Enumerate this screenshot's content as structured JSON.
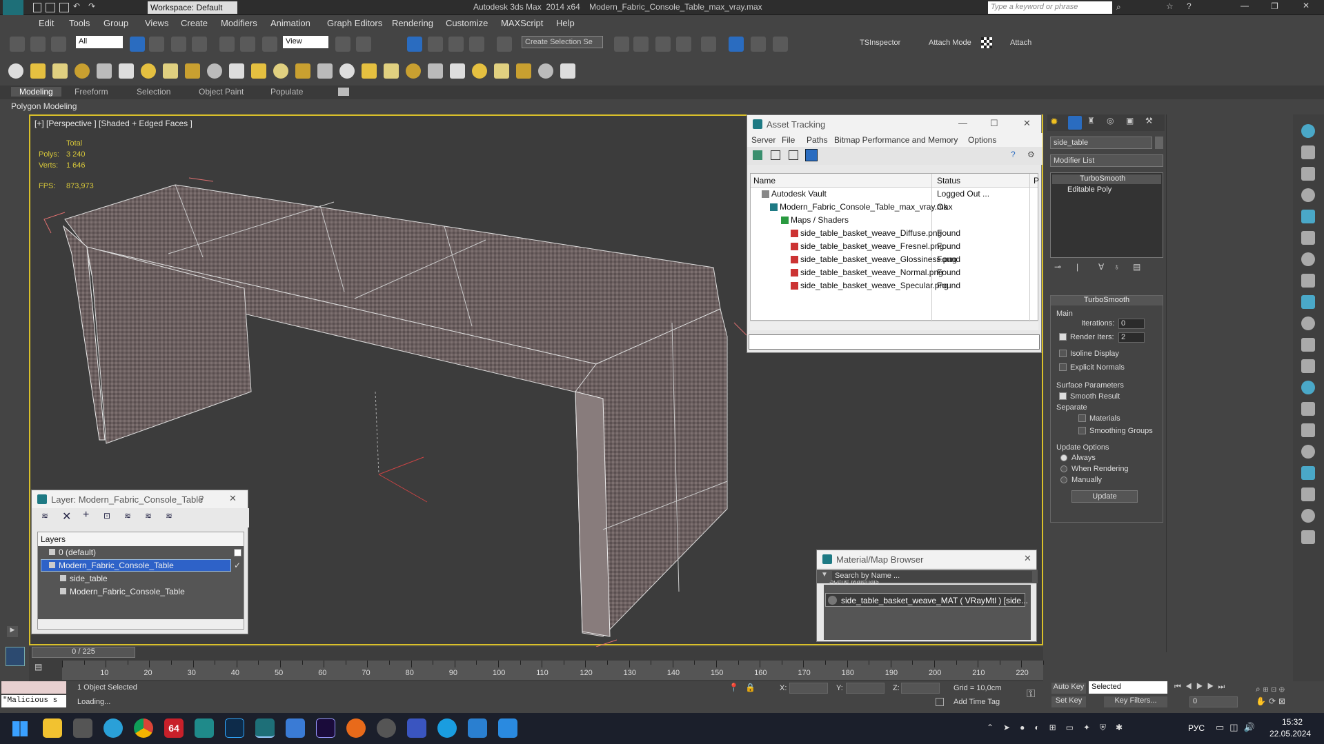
{
  "titlebar": {
    "workspace": "Workspace: Default",
    "title": "Autodesk 3ds Max  2014 x64    Modern_Fabric_Console_Table_max_vray.max",
    "search_placeholder": "Type a keyword or phrase"
  },
  "menu": [
    "Edit",
    "Tools",
    "Group",
    "Views",
    "Create",
    "Modifiers",
    "Animation",
    "Graph Editors",
    "Rendering",
    "Customize",
    "MAXScript",
    "Help"
  ],
  "toolbar": {
    "filter": "All",
    "view": "View",
    "selection_set": "Create Selection Se",
    "tsinspector": "TSInspector",
    "attach_mode": "Attach Mode",
    "attach": "Attach"
  },
  "ribbon": {
    "tabs": [
      "Modeling",
      "Freeform",
      "Selection",
      "Object Paint",
      "Populate"
    ],
    "sub": "Polygon Modeling"
  },
  "viewport": {
    "label": "[+] [Perspective ] [Shaded + Edged Faces ]",
    "total": "Total",
    "polys_label": "Polys:",
    "polys": "3 240",
    "verts_label": "Verts:",
    "verts": "1 646",
    "fps_label": "FPS:",
    "fps": "873,973"
  },
  "asset_tracking": {
    "title": "Asset Tracking",
    "menu": [
      "Server",
      "File",
      "Paths",
      "Bitmap Performance and Memory",
      "Options"
    ],
    "col_name": "Name",
    "col_status": "Status",
    "col_p": "P",
    "rows": [
      {
        "name": "Autodesk Vault",
        "status": "Logged Out ..."
      },
      {
        "name": "Modern_Fabric_Console_Table_max_vray.max",
        "status": "Ok"
      },
      {
        "name": "Maps / Shaders",
        "status": ""
      },
      {
        "name": "side_table_basket_weave_Diffuse.png",
        "status": "Found"
      },
      {
        "name": "side_table_basket_weave_Fresnel.png",
        "status": "Found"
      },
      {
        "name": "side_table_basket_weave_Glossiness.png",
        "status": "Found"
      },
      {
        "name": "side_table_basket_weave_Normal.png",
        "status": "Found"
      },
      {
        "name": "side_table_basket_weave_Specular.png",
        "status": "Found"
      }
    ]
  },
  "layer": {
    "title": "Layer: Modern_Fabric_Console_Table",
    "help": "?",
    "header": "Layers",
    "rows": [
      "0 (default)",
      "Modern_Fabric_Console_Table",
      "side_table",
      "Modern_Fabric_Console_Table"
    ]
  },
  "material_browser": {
    "title": "Material/Map Browser",
    "search_placeholder": "Search by Name ...",
    "group": "Scene Materials",
    "item": "side_table_basket_weave_MAT ( VRayMtl ) [side..."
  },
  "command_panel": {
    "object_name": "side_table",
    "modifier_list": "Modifier List",
    "stack": [
      "TurboSmooth",
      "Editable Poly"
    ],
    "rollout": "TurboSmooth",
    "main": "Main",
    "iterations_label": "Iterations:",
    "iterations": "0",
    "render_iters_label": "Render Iters:",
    "render_iters": "2",
    "isoline": "Isoline Display",
    "explicit": "Explicit Normals",
    "surface": "Surface Parameters",
    "smooth_result": "Smooth Result",
    "separate": "Separate",
    "materials": "Materials",
    "smoothing_groups": "Smoothing Groups",
    "update_options": "Update Options",
    "always": "Always",
    "when_rendering": "When Rendering",
    "manually": "Manually",
    "update": "Update"
  },
  "timeline": {
    "frame": "0 / 225",
    "ticks": [
      "10",
      "20",
      "30",
      "40",
      "50",
      "60",
      "70",
      "80",
      "90",
      "100",
      "110",
      "120",
      "130",
      "140",
      "150",
      "160",
      "170",
      "180",
      "190",
      "200",
      "210",
      "220"
    ]
  },
  "status": {
    "selected": "1 Object Selected",
    "loading": "Loading...",
    "script": "\"Malicious s",
    "x": "X:",
    "y": "Y:",
    "z": "Z:",
    "grid": "Grid = 10,0cm",
    "add_time_tag": "Add Time Tag",
    "auto_key": "Auto Key",
    "set_key": "Set Key",
    "selected_dd": "Selected",
    "key_filters": "Key Filters...",
    "frame": "0"
  },
  "taskbar": {
    "lang": "РУС",
    "time": "15:32",
    "date": "22.05.2024",
    "badge": "64"
  }
}
